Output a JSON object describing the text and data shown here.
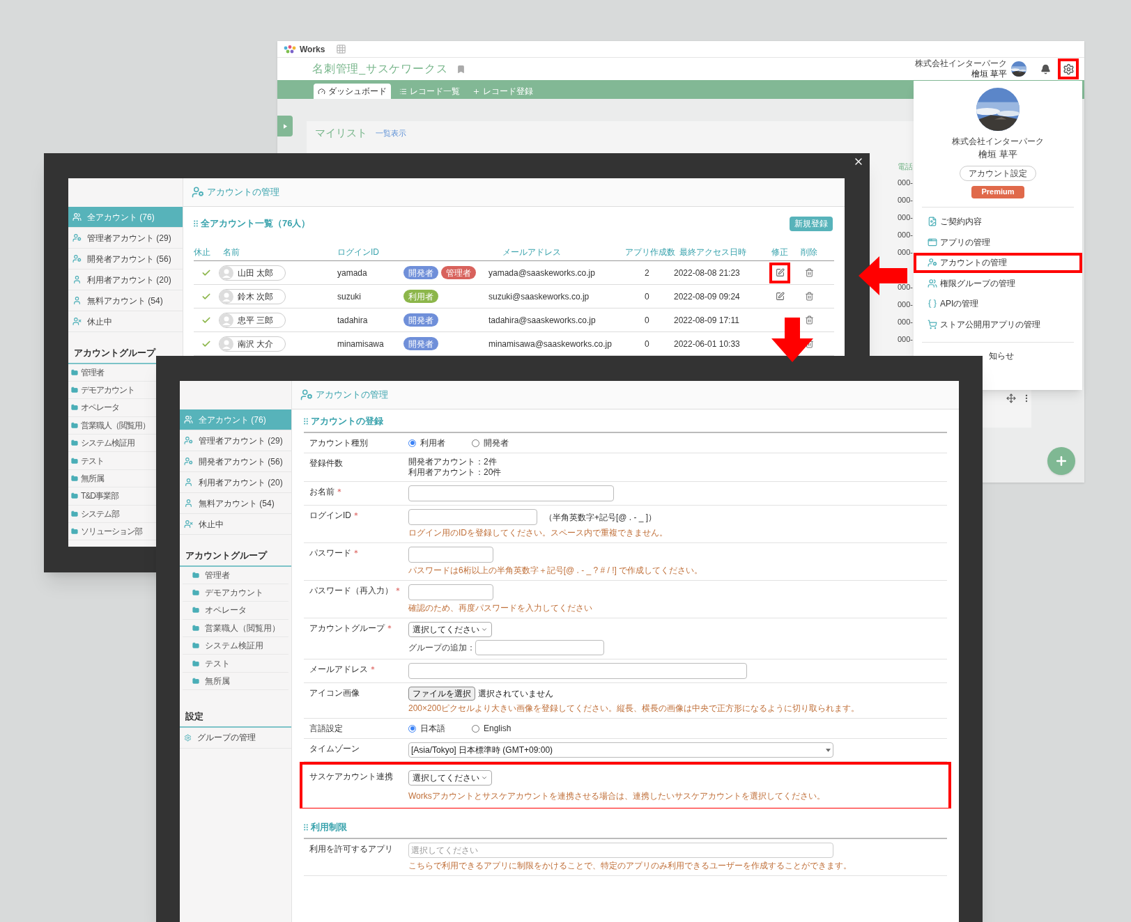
{
  "back_window": {
    "logo_text": "Works",
    "app_title": "名刺管理_サスケワークス",
    "tabs": [
      {
        "label": "ダッシュボード",
        "kind": "dashboard",
        "selected": true
      },
      {
        "label": "レコード一覧",
        "kind": "list",
        "selected": false
      },
      {
        "label": "レコード登録",
        "kind": "add",
        "selected": false
      }
    ],
    "header_company": "株式会社インターパーク",
    "header_user": "檜垣 草平",
    "settings_highlighted": true,
    "mylist_title": "マイリスト",
    "mylist_link": "一覧表示",
    "column_header": "電話",
    "phone_cells": [
      "000-",
      "000-",
      "000-",
      "000-",
      "000-",
      "000-",
      "000-",
      "000-",
      "000-"
    ]
  },
  "user_menu": {
    "company": "株式会社インターパーク",
    "name": "檜垣 草平",
    "settings_button": "アカウント設定",
    "plan_badge": "Premium",
    "items": [
      {
        "label": "ご契約内容",
        "kind": "contract",
        "highlighted": false
      },
      {
        "label": "アプリの管理",
        "kind": "app",
        "highlighted": false
      },
      {
        "label": "アカウントの管理",
        "kind": "account",
        "highlighted": true
      },
      {
        "label": "権限グループの管理",
        "kind": "group",
        "highlighted": false
      },
      {
        "label": "APIの管理",
        "kind": "api",
        "highlighted": false
      },
      {
        "label": "ストア公開用アプリの管理",
        "kind": "store",
        "highlighted": false
      }
    ],
    "partial_item": "知らせ"
  },
  "account_list_window": {
    "header": "アカウントの管理",
    "sidebar": {
      "items": [
        {
          "label": "全アカウント (76)",
          "kind": "all",
          "selected": true
        },
        {
          "label": "管理者アカウント (29)",
          "kind": "admin",
          "selected": false
        },
        {
          "label": "開発者アカウント (56)",
          "kind": "developer",
          "selected": false
        },
        {
          "label": "利用者アカウント (20)",
          "kind": "user",
          "selected": false
        },
        {
          "label": "無料アカウント (54)",
          "kind": "user",
          "selected": false
        },
        {
          "label": "休止中",
          "kind": "suspended",
          "selected": false
        }
      ],
      "group_title": "アカウントグループ",
      "groups": [
        "管理者",
        "デモアカウント",
        "オペレータ",
        "営業職人（閲覧用）",
        "システム検証用",
        "テスト",
        "無所属",
        "T&D事業部",
        "システム部",
        "ソリューション部"
      ]
    },
    "list_title": "全アカウント一覧（76人）",
    "new_button": "新規登録",
    "columns": [
      "休止",
      "名前",
      "ログインID",
      "メールアドレス",
      "アプリ作成数",
      "最終アクセス日時",
      "修正",
      "削除"
    ],
    "rows": [
      {
        "active": true,
        "name": "山田 太郎",
        "login_id": "yamada",
        "roles": [
          {
            "label": "開発者",
            "color": "#6f8fd9"
          },
          {
            "label": "管理者",
            "color": "#d8625c"
          }
        ],
        "email": "yamada@saaskeworks.co.jp",
        "app_count": "2",
        "last_access": "2022-08-08 21:23",
        "edit": true,
        "edit_highlighted": true
      },
      {
        "active": true,
        "name": "鈴木 次郎",
        "login_id": "suzuki",
        "roles": [
          {
            "label": "利用者",
            "color": "#8cb64a"
          }
        ],
        "email": "suzuki@saaskeworks.co.jp",
        "app_count": "0",
        "last_access": "2022-08-09 09:24",
        "edit": true,
        "edit_highlighted": false
      },
      {
        "active": true,
        "name": "忠平 三郎",
        "login_id": "tadahira",
        "roles": [
          {
            "label": "開発者",
            "color": "#6f8fd9"
          }
        ],
        "email": "tadahira@saaskeworks.co.jp",
        "app_count": "0",
        "last_access": "2022-08-09 17:11",
        "edit": false,
        "edit_highlighted": false
      },
      {
        "active": true,
        "name": "南沢 大介",
        "login_id": "minamisawa",
        "roles": [
          {
            "label": "開発者",
            "color": "#6f8fd9"
          }
        ],
        "email": "minamisawa@saaskeworks.co.jp",
        "app_count": "0",
        "last_access": "2022-06-01 10:33",
        "edit": false,
        "edit_highlighted": false
      }
    ]
  },
  "registration_window": {
    "header": "アカウントの管理",
    "sidebar": {
      "items": [
        {
          "label": "全アカウント (76)",
          "kind": "all",
          "selected": true
        },
        {
          "label": "管理者アカウント (29)",
          "kind": "admin",
          "selected": false
        },
        {
          "label": "開発者アカウント (56)",
          "kind": "developer",
          "selected": false
        },
        {
          "label": "利用者アカウント (20)",
          "kind": "user",
          "selected": false
        },
        {
          "label": "無料アカウント (54)",
          "kind": "user",
          "selected": false
        },
        {
          "label": "休止中",
          "kind": "suspended",
          "selected": false
        }
      ],
      "group_title": "アカウントグループ",
      "groups": [
        "管理者",
        "デモアカウント",
        "オペレータ",
        "営業職人（閲覧用）",
        "システム検証用",
        "テスト",
        "無所属"
      ],
      "settings_title": "設定",
      "settings_items": [
        "グループの管理"
      ]
    },
    "required_mark": "＊",
    "sections": [
      {
        "title": "アカウントの登録",
        "rows": [
          {
            "kind": "radio",
            "label": "アカウント種別",
            "required": false,
            "options": [
              {
                "label": "利用者",
                "selected": true
              },
              {
                "label": "開発者",
                "selected": false
              }
            ]
          },
          {
            "kind": "text",
            "label": "登録件数",
            "required": false,
            "lines": [
              "開発者アカウント：2件",
              "利用者アカウント：20件"
            ]
          },
          {
            "kind": "input",
            "label": "お名前",
            "required": true
          },
          {
            "kind": "input",
            "label": "ログインID",
            "required": true,
            "note": "（半角英数字+記号[@ . - _ ]）",
            "hint": "ログイン用のIDを登録してください。スペース内で重複できません。"
          },
          {
            "kind": "input",
            "label": "パスワード",
            "required": true,
            "hint": "パスワードは6桁以上の半角英数字＋記号[@ . - _ ? # / !] で作成してください。"
          },
          {
            "kind": "input",
            "label": "パスワード（再入力）",
            "required": true,
            "hint": "確認のため、再度パスワードを入力してください"
          },
          {
            "kind": "group_select",
            "label": "アカウントグループ",
            "required": true,
            "value": "選択してください",
            "add_label": "グループの追加："
          },
          {
            "kind": "input",
            "label": "メールアドレス",
            "required": true
          },
          {
            "kind": "file",
            "label": "アイコン画像",
            "required": false,
            "button": "ファイルを選択",
            "status": "選択されていません",
            "hint": "200×200ピクセルより大きい画像を登録してください。縦長、横長の画像は中央で正方形になるように切り取られます。"
          },
          {
            "kind": "radio",
            "label": "言語設定",
            "required": false,
            "options": [
              {
                "label": "日本語",
                "selected": true
              },
              {
                "label": "English",
                "selected": false
              }
            ]
          },
          {
            "kind": "wide_select",
            "label": "タイムゾーン",
            "required": false,
            "value": "[Asia/Tokyo] 日本標準時 (GMT+09:00)"
          },
          {
            "kind": "select",
            "label": "サスケアカウント連携",
            "required": false,
            "value": "選択してください",
            "hint": "Worksアカウントとサスケアカウントを連携させる場合は、連携したいサスケアカウントを選択してください。",
            "highlighted": true
          }
        ]
      },
      {
        "title": "利用制限",
        "rows": [
          {
            "kind": "multi_select",
            "label": "利用を許可するアプリ",
            "required": false,
            "placeholder": "選択してください",
            "hint": "こちらで利用できるアプリに制限をかけることで、特定のアプリのみ利用できるユーザーを作成することができます。"
          }
        ]
      }
    ]
  }
}
